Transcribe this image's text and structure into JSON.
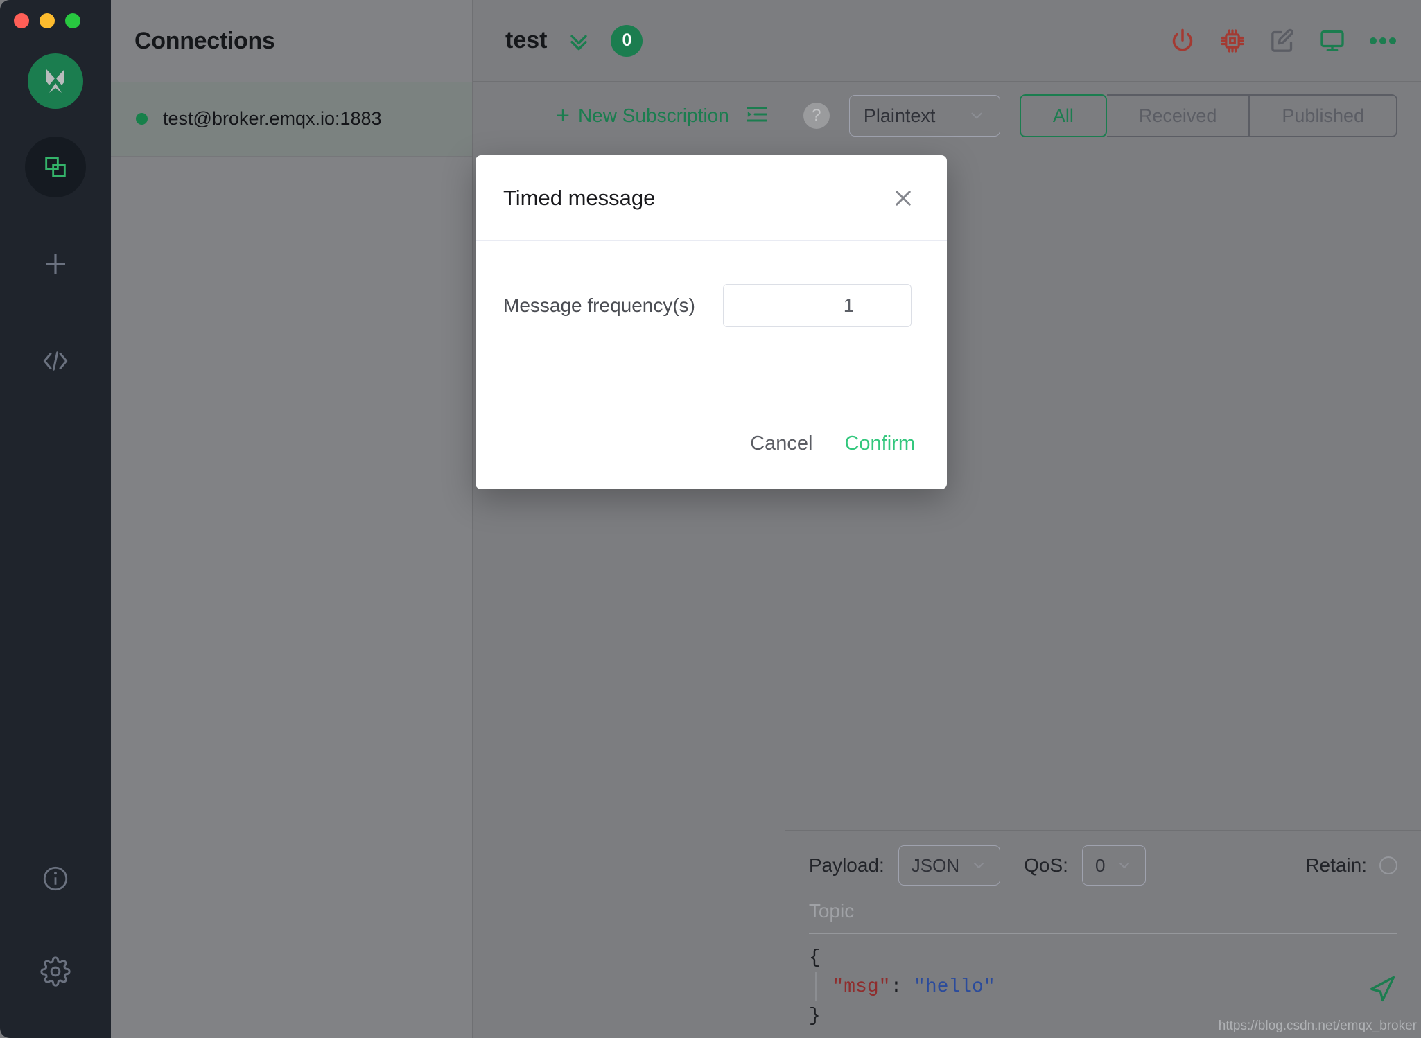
{
  "window": {
    "traffic_lights": [
      "close",
      "minimize",
      "zoom"
    ],
    "colors": {
      "close": "#ff5f57",
      "minimize": "#febc2e",
      "zoom": "#28c840",
      "brand_green": "#1b7d4f",
      "accent_green": "#33c77d",
      "sidebar_bg": "#1f242c"
    }
  },
  "activity_bar": {
    "logo_name": "mqttx-logo",
    "items": [
      {
        "icon": "connections-icon",
        "name": "sidebar-item-connections",
        "active": true
      },
      {
        "icon": "plus-icon",
        "name": "sidebar-item-new-connection",
        "active": false
      },
      {
        "icon": "code-icon",
        "name": "sidebar-item-script",
        "active": false
      },
      {
        "icon": "info-icon",
        "name": "sidebar-item-about",
        "active": false
      },
      {
        "icon": "gear-icon",
        "name": "sidebar-item-settings",
        "active": false
      }
    ]
  },
  "connections": {
    "title": "Connections",
    "items": [
      {
        "label": "test@broker.emqx.io:1883",
        "status": "connected",
        "status_color": "#17804a"
      }
    ]
  },
  "main": {
    "title": "test",
    "collapse_icon": "double-chevron-down-icon",
    "message_count": "0",
    "tools": [
      {
        "name": "disconnect-icon",
        "icon": "power-icon",
        "color": "#a33a32"
      },
      {
        "name": "broker-info-icon",
        "icon": "chip-icon",
        "color": "#a33a32"
      },
      {
        "name": "edit-connection-icon",
        "icon": "edit-square-icon",
        "color": "#5b5d64"
      },
      {
        "name": "monitor-icon",
        "icon": "display-icon",
        "color": "#1b7d4f"
      },
      {
        "name": "more-options-icon",
        "icon": "ellipsis-icon",
        "color": "#1b7d4f"
      }
    ]
  },
  "subscriptions": {
    "new_subscription_label": "New Subscription",
    "plus_glyph": "+",
    "collapse_icon": "collapse-left-icon"
  },
  "messages_toolbar": {
    "help_glyph": "?",
    "format_select": {
      "value": "Plaintext",
      "chevron": "chevron-down-icon"
    },
    "filters": [
      {
        "label": "All",
        "active": true
      },
      {
        "label": "Received",
        "active": false
      },
      {
        "label": "Published",
        "active": false
      }
    ]
  },
  "composer": {
    "payload_label": "Payload:",
    "payload_value": "JSON",
    "qos_label": "QoS:",
    "qos_value": "0",
    "retain_label": "Retain:",
    "retain_checked": false,
    "topic_placeholder": "Topic",
    "topic_value": "",
    "payload_lines": [
      {
        "text": "{",
        "type": "punct"
      },
      {
        "key": "\"msg\"",
        "colon": ": ",
        "value": "\"hello\"",
        "type": "pair"
      },
      {
        "text": "}",
        "type": "punct"
      }
    ],
    "send_icon": "send-icon",
    "watermark": "https://blog.csdn.net/emqx_broker"
  },
  "modal": {
    "title": "Timed message",
    "close_icon": "close-icon",
    "field_label": "Message frequency(s)",
    "field_value": "1",
    "spin_up_icon": "chevron-up-icon",
    "spin_down_icon": "chevron-down-icon",
    "cancel_label": "Cancel",
    "confirm_label": "Confirm"
  }
}
